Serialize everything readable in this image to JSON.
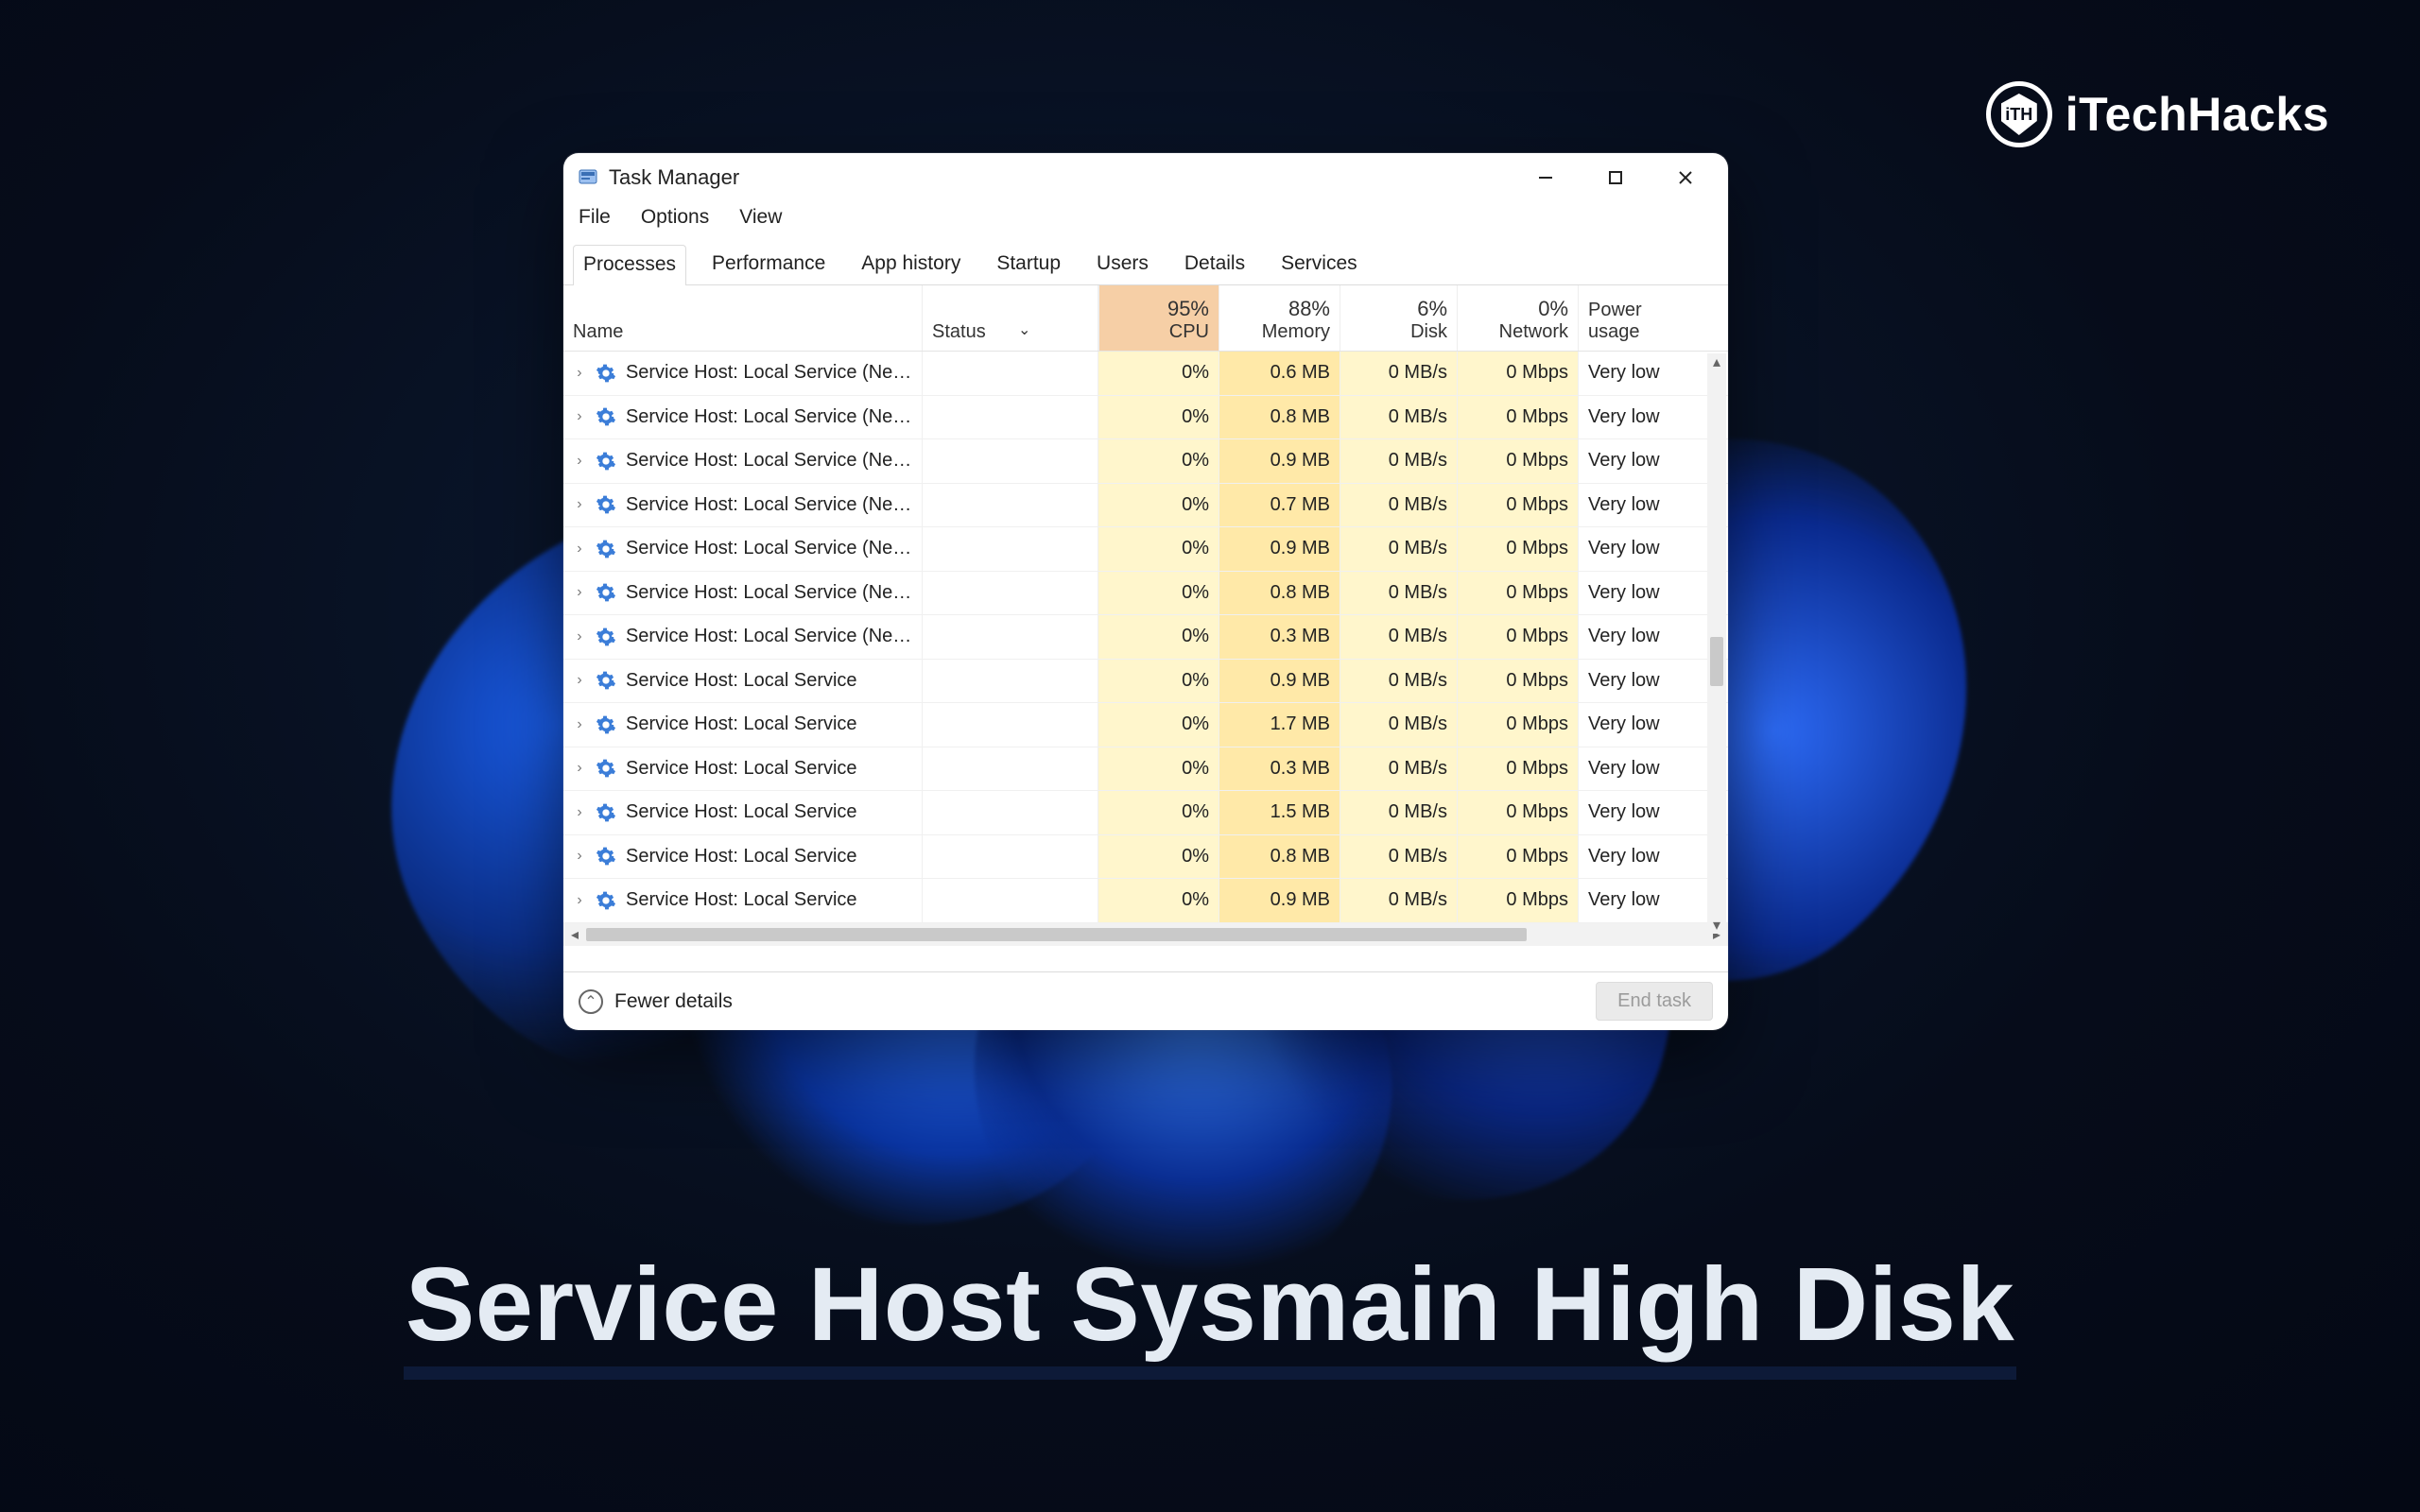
{
  "brand": {
    "name": "iTechHacks",
    "shield_text": "iTH"
  },
  "headline": "Service Host Sysmain High Disk",
  "window": {
    "title": "Task Manager",
    "menus": [
      "File",
      "Options",
      "View"
    ],
    "tabs": [
      "Processes",
      "Performance",
      "App history",
      "Startup",
      "Users",
      "Details",
      "Services"
    ],
    "active_tab_index": 0,
    "columns": {
      "name": "Name",
      "status": "Status",
      "cpu": {
        "pct": "95%",
        "label": "CPU"
      },
      "memory": {
        "pct": "88%",
        "label": "Memory"
      },
      "disk": {
        "pct": "6%",
        "label": "Disk"
      },
      "network": {
        "pct": "0%",
        "label": "Network"
      },
      "power": "Power usage"
    },
    "rows": [
      {
        "name": "Service Host: Local Service (Net...",
        "cpu": "0%",
        "mem": "0.6 MB",
        "disk": "0 MB/s",
        "net": "0 Mbps",
        "power": "Very low"
      },
      {
        "name": "Service Host: Local Service (Net...",
        "cpu": "0%",
        "mem": "0.8 MB",
        "disk": "0 MB/s",
        "net": "0 Mbps",
        "power": "Very low"
      },
      {
        "name": "Service Host: Local Service (Net...",
        "cpu": "0%",
        "mem": "0.9 MB",
        "disk": "0 MB/s",
        "net": "0 Mbps",
        "power": "Very low"
      },
      {
        "name": "Service Host: Local Service (Net...",
        "cpu": "0%",
        "mem": "0.7 MB",
        "disk": "0 MB/s",
        "net": "0 Mbps",
        "power": "Very low"
      },
      {
        "name": "Service Host: Local Service (Net...",
        "cpu": "0%",
        "mem": "0.9 MB",
        "disk": "0 MB/s",
        "net": "0 Mbps",
        "power": "Very low"
      },
      {
        "name": "Service Host: Local Service (Net...",
        "cpu": "0%",
        "mem": "0.8 MB",
        "disk": "0 MB/s",
        "net": "0 Mbps",
        "power": "Very low"
      },
      {
        "name": "Service Host: Local Service (Net...",
        "cpu": "0%",
        "mem": "0.3 MB",
        "disk": "0 MB/s",
        "net": "0 Mbps",
        "power": "Very low"
      },
      {
        "name": "Service Host: Local Service",
        "cpu": "0%",
        "mem": "0.9 MB",
        "disk": "0 MB/s",
        "net": "0 Mbps",
        "power": "Very low"
      },
      {
        "name": "Service Host: Local Service",
        "cpu": "0%",
        "mem": "1.7 MB",
        "disk": "0 MB/s",
        "net": "0 Mbps",
        "power": "Very low"
      },
      {
        "name": "Service Host: Local Service",
        "cpu": "0%",
        "mem": "0.3 MB",
        "disk": "0 MB/s",
        "net": "0 Mbps",
        "power": "Very low"
      },
      {
        "name": "Service Host: Local Service",
        "cpu": "0%",
        "mem": "1.5 MB",
        "disk": "0 MB/s",
        "net": "0 Mbps",
        "power": "Very low"
      },
      {
        "name": "Service Host: Local Service",
        "cpu": "0%",
        "mem": "0.8 MB",
        "disk": "0 MB/s",
        "net": "0 Mbps",
        "power": "Very low"
      },
      {
        "name": "Service Host: Local Service",
        "cpu": "0%",
        "mem": "0.9 MB",
        "disk": "0 MB/s",
        "net": "0 Mbps",
        "power": "Very low"
      }
    ],
    "footer": {
      "fewer_details": "Fewer details",
      "end_task": "End task"
    }
  }
}
